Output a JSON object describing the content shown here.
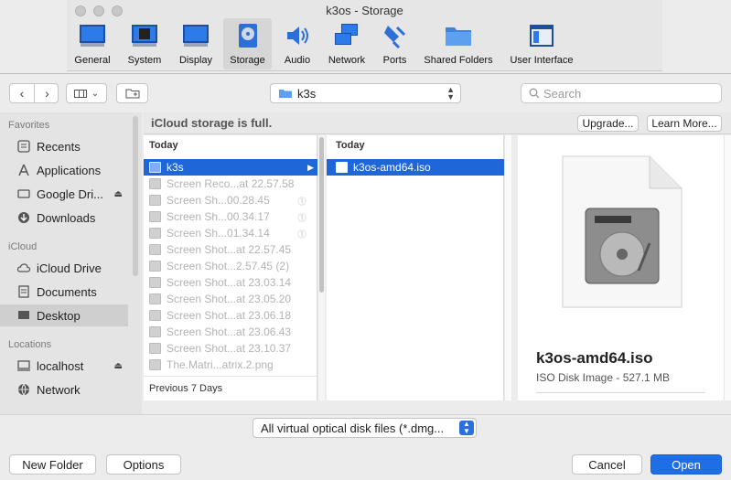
{
  "settings_window": {
    "title": "k3os - Storage",
    "tabs": [
      {
        "label": "General"
      },
      {
        "label": "System"
      },
      {
        "label": "Display"
      },
      {
        "label": "Storage"
      },
      {
        "label": "Audio"
      },
      {
        "label": "Network"
      },
      {
        "label": "Ports"
      },
      {
        "label": "Shared Folders"
      },
      {
        "label": "User Interface"
      }
    ],
    "selected_tab": "Storage"
  },
  "toolbar": {
    "location": "k3s",
    "search_placeholder": "Search"
  },
  "sidebar": {
    "favorites_header": "Favorites",
    "favorites": [
      {
        "label": "Recents",
        "icon": "clock-icon"
      },
      {
        "label": "Applications",
        "icon": "applications-icon"
      },
      {
        "label": "Google Dri...",
        "icon": "drive-icon",
        "eject": true
      },
      {
        "label": "Downloads",
        "icon": "download-icon"
      }
    ],
    "icloud_header": "iCloud",
    "icloud": [
      {
        "label": "iCloud Drive",
        "icon": "cloud-icon"
      },
      {
        "label": "Documents",
        "icon": "document-icon"
      },
      {
        "label": "Desktop",
        "icon": "desktop-icon",
        "selected": true
      }
    ],
    "locations_header": "Locations",
    "locations": [
      {
        "label": "localhost",
        "icon": "computer-icon",
        "eject": true
      },
      {
        "label": "Network",
        "icon": "globe-icon"
      }
    ]
  },
  "banner": {
    "message": "iCloud storage is full.",
    "upgrade_label": "Upgrade...",
    "learn_more_label": "Learn More..."
  },
  "column1": {
    "header": "Today",
    "items": [
      {
        "name": "k3s",
        "selected": true
      },
      {
        "name": "Screen Reco...at 22.57.58"
      },
      {
        "name": "Screen Sh...00.28.45"
      },
      {
        "name": "Screen Sh...00.34.17"
      },
      {
        "name": "Screen Sh...01.34.14"
      },
      {
        "name": "Screen Shot...at 22.57.45"
      },
      {
        "name": "Screen Shot...2.57.45 (2)"
      },
      {
        "name": "Screen Shot...at 23.03.14"
      },
      {
        "name": "Screen Shot...at 23.05.20"
      },
      {
        "name": "Screen Shot...at 23.06.18"
      },
      {
        "name": "Screen Shot...at 23.06.43"
      },
      {
        "name": "Screen Shot...at 23.10.37"
      },
      {
        "name": "The.Matri...atrix.2.png"
      }
    ],
    "footer": "Previous 7 Days"
  },
  "column2": {
    "header": "Today",
    "items": [
      {
        "name": "k3os-amd64.iso",
        "selected": true
      }
    ]
  },
  "preview": {
    "name": "k3os-amd64.iso",
    "info": "ISO Disk Image - 527.1 MB"
  },
  "filter": {
    "value": "All virtual optical disk files (*.dmg..."
  },
  "buttons": {
    "new_folder": "New Folder",
    "options": "Options",
    "cancel": "Cancel",
    "open": "Open"
  }
}
